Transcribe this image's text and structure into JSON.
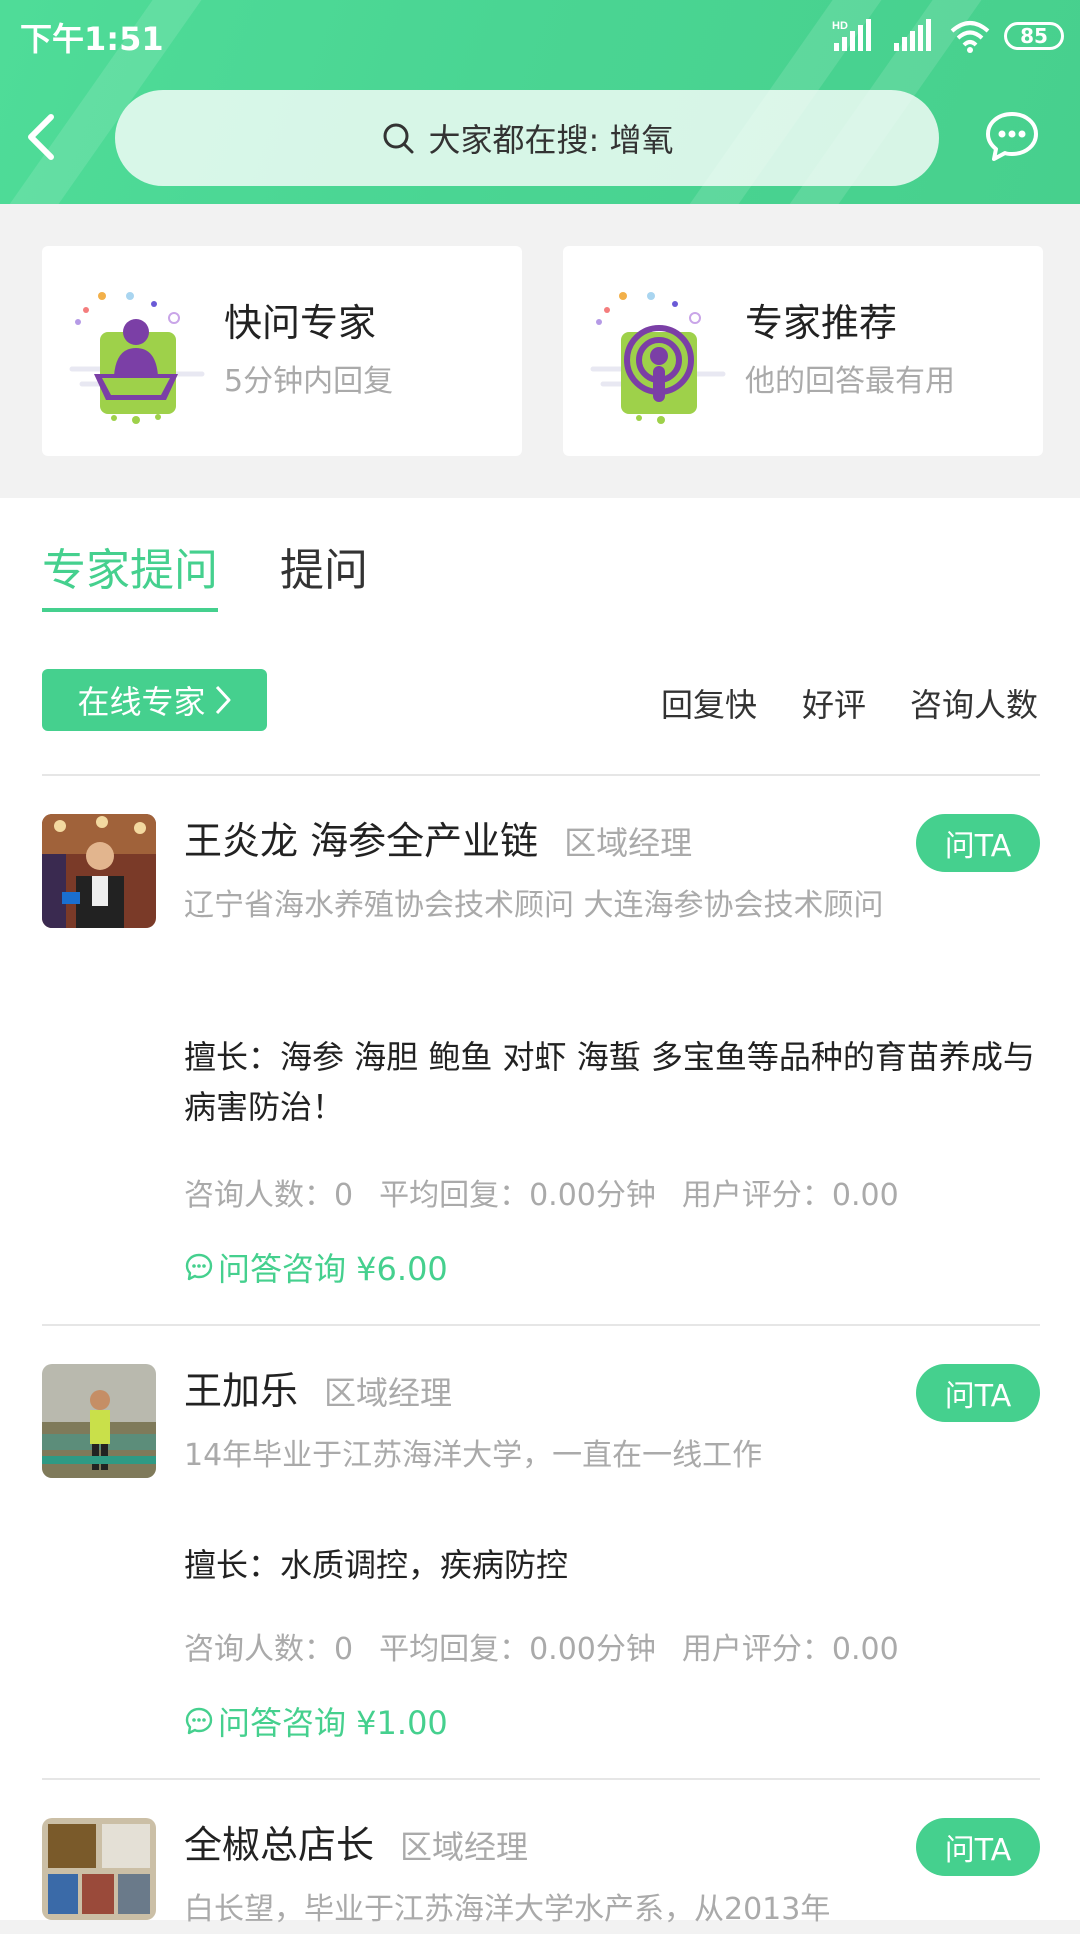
{
  "status_bar": {
    "time": "下午1:51",
    "battery": "85",
    "signal_label": "HD"
  },
  "header": {
    "search_placeholder": "大家都在搜: 增氧"
  },
  "quick_cards": [
    {
      "title": "快问专家",
      "subtitle": "5分钟内回复"
    },
    {
      "title": "专家推荐",
      "subtitle": "他的回答最有用"
    }
  ],
  "tabs": [
    {
      "label": "专家提问",
      "active": true
    },
    {
      "label": "提问",
      "active": false
    }
  ],
  "filter": {
    "online_label": "在线专家",
    "sort_options": [
      "回复快",
      "好评",
      "咨询人数"
    ]
  },
  "experts": [
    {
      "name": "王炎龙 海参全产业链",
      "role": "区域经理",
      "desc": "辽宁省海水养殖协会技术顾问 大连海参协会技术顾问",
      "skill": "擅长：海参 海胆 鲍鱼 对虾 海蜇 多宝鱼等品种的育苗养成与病害防治！",
      "stats": [
        "咨询人数：0",
        "平均回复：0.00分钟",
        "用户评分：0.00"
      ],
      "price": "问答咨询 ¥6.00",
      "ask_label": "问TA"
    },
    {
      "name": "王加乐",
      "role": "区域经理",
      "desc": "14年毕业于江苏海洋大学，一直在一线工作",
      "skill": "擅长：水质调控，疾病防控",
      "stats": [
        "咨询人数：0",
        "平均回复：0.00分钟",
        "用户评分：0.00"
      ],
      "price": "问答咨询 ¥1.00",
      "ask_label": "问TA"
    },
    {
      "name": "全椒总店长",
      "role": "区域经理",
      "desc": "白长望，毕业于江苏海洋大学水产系，从2013年",
      "ask_label": "问TA"
    }
  ],
  "colors": {
    "accent": "#45d08e",
    "header": "#4ad593"
  }
}
